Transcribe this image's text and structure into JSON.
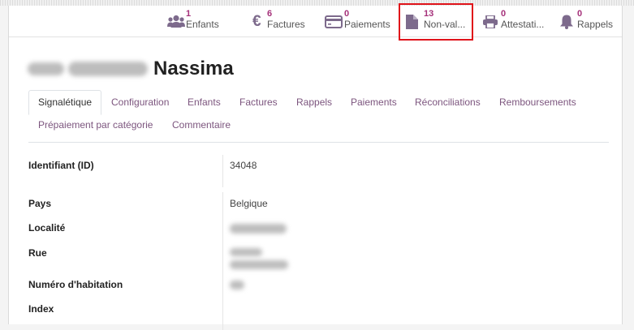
{
  "stat_buttons": [
    {
      "count": "1",
      "label": "Enfants",
      "icon": "users-icon"
    },
    {
      "count": "6",
      "label": "Factures",
      "icon": "euro-icon"
    },
    {
      "count": "0",
      "label": "Paiements",
      "icon": "credit-card-icon"
    },
    {
      "count": "13",
      "label": "Non-val...",
      "icon": "file-icon"
    },
    {
      "count": "0",
      "label": "Attestati...",
      "icon": "printer-icon"
    },
    {
      "count": "0",
      "label": "Rappels",
      "icon": "bell-icon"
    }
  ],
  "record": {
    "name": "Nassima"
  },
  "tabs": [
    "Signalétique",
    "Configuration",
    "Enfants",
    "Factures",
    "Rappels",
    "Paiements",
    "Réconciliations",
    "Remboursements",
    "Prépaiement par catégorie",
    "Commentaire"
  ],
  "fields": {
    "identifiant": {
      "label": "Identifiant (ID)",
      "value": "34048"
    },
    "pays": {
      "label": "Pays",
      "value": "Belgique"
    },
    "localite": {
      "label": "Localité"
    },
    "rue": {
      "label": "Rue"
    },
    "numero": {
      "label": "Numéro d'habitation"
    },
    "index": {
      "label": "Index"
    }
  },
  "colors": {
    "accent": "#a5307a",
    "tab_link": "#7c557e",
    "highlight": "#e0131a"
  }
}
